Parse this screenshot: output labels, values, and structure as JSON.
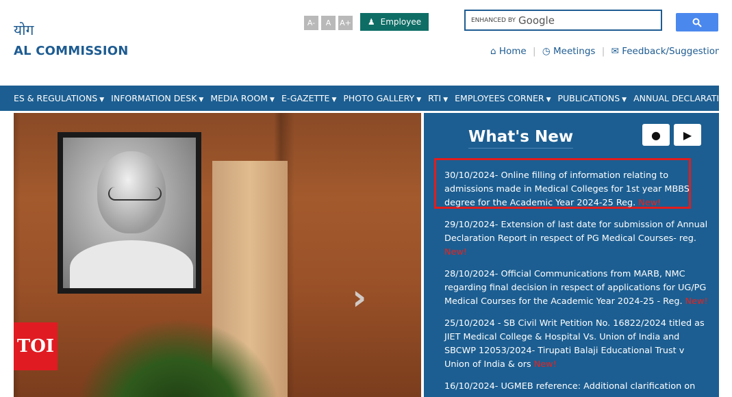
{
  "header": {
    "hindi_title": "योग",
    "english_title": "AL COMMISSION",
    "font_size_buttons": [
      "A-",
      "A",
      "A+"
    ],
    "employee_label": "Employee",
    "search": {
      "prefix": "ENHANCED BY",
      "brand": "Google"
    },
    "top_links": [
      "Home",
      "Meetings",
      "Feedback/Suggestion"
    ]
  },
  "nav": {
    "items": [
      "ES & REGULATIONS",
      "INFORMATION DESK",
      "MEDIA ROOM",
      "E-GAZETTE",
      "PHOTO GALLERY",
      "RTI",
      "EMPLOYEES CORNER",
      "PUBLICATIONS",
      "ANNUAL DECLARATIO"
    ]
  },
  "overlay": {
    "logo_text": "TOI"
  },
  "whats_new": {
    "title": "What's New",
    "new_label": "New!",
    "items": [
      {
        "text": "30/10/2024- Online filling of information relating to admissions made in Medical Colleges for 1st year MBBS degree for the Academic Year 2024-25 Reg.",
        "highlighted": true
      },
      {
        "text": "29/10/2024- Extension of last date for submission of Annual Declaration Report in respect of PG Medical Courses- reg."
      },
      {
        "text": "28/10/2024- Official Communications from MARB, NMC regarding final decision in respect of applications for UG/PG Medical Courses for the Academic Year 2024-25 - Reg."
      },
      {
        "text": "25/10/2024 - SB Civil Writ Petition No. 16822/2024 titled as JIET Medical College & Hospital Vs. Union of India and SBCWP 12053/2024- Tirupati Balaji Educational Trust v Union of India & ors"
      },
      {
        "text": "16/10/2024- UGMEB reference: Additional clarification on"
      }
    ]
  }
}
